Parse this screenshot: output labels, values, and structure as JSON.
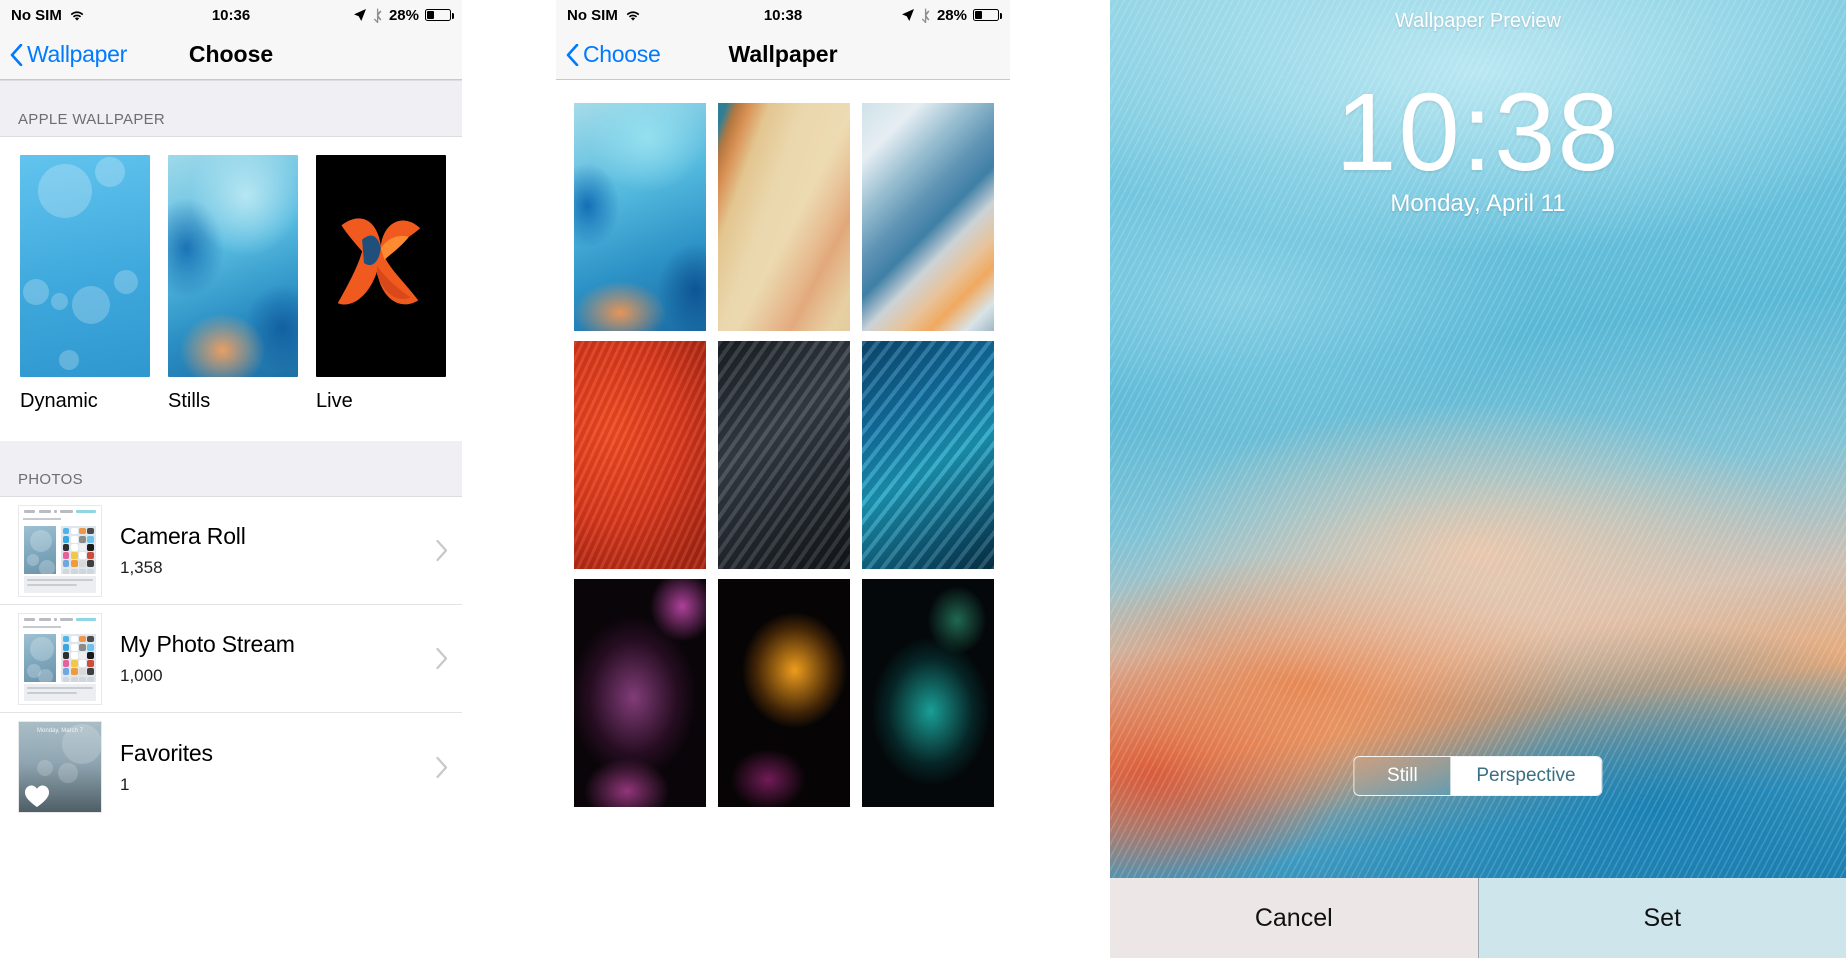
{
  "panels": {
    "choose": {
      "status": {
        "carrier": "No SIM",
        "time": "10:36",
        "battery": "28%",
        "battery_level": 28,
        "wifi_icon": "wifi-icon",
        "location_icon": "location-arrow-icon",
        "bluetooth_icon": "bluetooth-icon",
        "battery_icon": "battery-icon"
      },
      "nav": {
        "back_label": "Wallpaper",
        "title": "Choose",
        "back_icon": "chevron-left-icon"
      },
      "sections": [
        {
          "header": "APPLE WALLPAPER"
        },
        {
          "header": "PHOTOS"
        }
      ],
      "types": [
        {
          "label": "Dynamic",
          "art": "wp-dynamic"
        },
        {
          "label": "Stills",
          "art": "wp-stills"
        },
        {
          "label": "Live",
          "art": "wp-live"
        }
      ],
      "albums": [
        {
          "title": "Camera Roll",
          "count": "1,358",
          "chevron_icon": "chevron-right-icon"
        },
        {
          "title": "My Photo Stream",
          "count": "1,000",
          "chevron_icon": "chevron-right-icon"
        },
        {
          "title": "Favorites",
          "count": "1",
          "chevron_icon": "chevron-right-icon",
          "thumb_date": "Monday, March 7",
          "heart_icon": "heart-icon"
        }
      ]
    },
    "wallpaper": {
      "status": {
        "carrier": "No SIM",
        "time": "10:38",
        "battery": "28%",
        "battery_level": 28,
        "wifi_icon": "wifi-icon",
        "location_icon": "location-arrow-icon",
        "bluetooth_icon": "bluetooth-icon",
        "battery_icon": "battery-icon"
      },
      "nav": {
        "back_label": "Choose",
        "title": "Wallpaper",
        "back_icon": "chevron-left-icon"
      },
      "grid": [
        {
          "name": "still-blue-water",
          "art": "g1"
        },
        {
          "name": "still-sand-dune",
          "art": "g2"
        },
        {
          "name": "still-silk-fold",
          "art": "g3"
        },
        {
          "name": "still-red-feather",
          "art": "g4"
        },
        {
          "name": "still-grey-feather",
          "art": "g5"
        },
        {
          "name": "still-blue-feather",
          "art": "g6"
        },
        {
          "name": "still-purple-rose",
          "art": "g7"
        },
        {
          "name": "still-orange-bloom",
          "art": "g8"
        },
        {
          "name": "still-teal-leaf",
          "art": "g9"
        }
      ]
    },
    "preview": {
      "title": "Wallpaper Preview",
      "time": "10:38",
      "date": "Monday, April 11",
      "segments": [
        {
          "label": "Still",
          "active": false
        },
        {
          "label": "Perspective",
          "active": true
        }
      ],
      "actions": [
        {
          "label": "Cancel",
          "id": "btn-cancel"
        },
        {
          "label": "Set",
          "id": "btn-set"
        }
      ]
    }
  },
  "colors": {
    "accent_blue": "#007aff",
    "section_bg": "#efeff4",
    "bar_bg": "#f7f7f7",
    "separator": "#c8c7cc",
    "set_bg": "#cfe5ec",
    "cancel_bg": "#ece7e6"
  }
}
